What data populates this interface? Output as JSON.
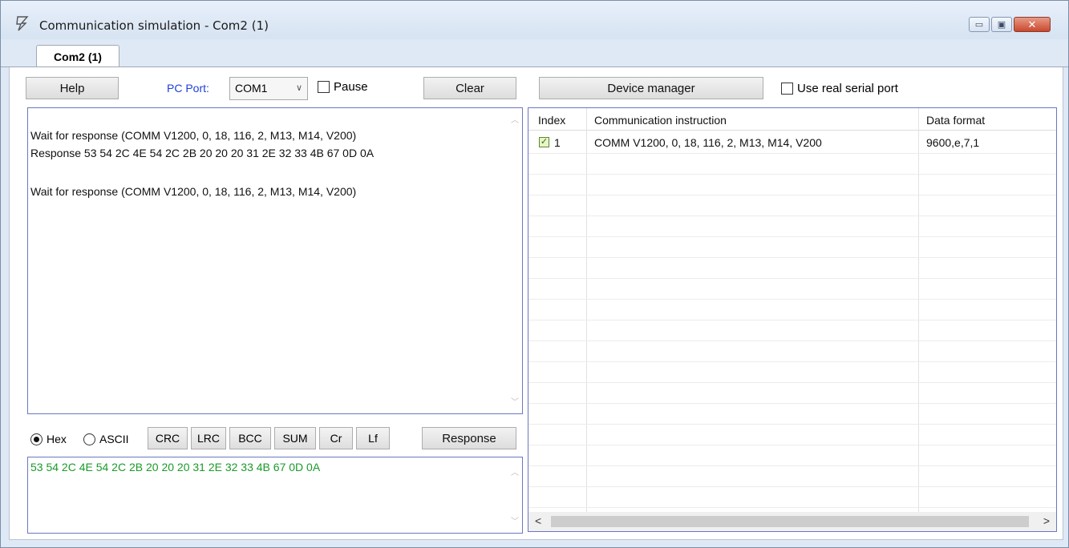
{
  "window": {
    "title": "Communication simulation - Com2 (1)",
    "minimize_glyph": "▭",
    "restore_glyph": "▣",
    "close_glyph": "✕"
  },
  "tabs": [
    {
      "label": "Com2 (1)",
      "active": true
    }
  ],
  "toolbar": {
    "help_label": "Help",
    "pc_port_label": "PC Port:",
    "pc_port_value": "COM1",
    "pause_label": "Pause",
    "pause_checked": false,
    "clear_label": "Clear",
    "device_manager_label": "Device manager",
    "use_real_serial_label": "Use real serial port",
    "use_real_serial_checked": false
  },
  "log": {
    "lines": [
      "Wait for response (COMM  V1200, 0, 18, 116, 2, M13, M14, V200)",
      "Response 53 54 2C 4E 54 2C 2B 20 20 20 31 2E 32 33 4B 67 0D 0A",
      "",
      "Wait for response (COMM  V1200, 0, 18, 116, 2, M13, M14, V200)"
    ]
  },
  "format": {
    "hex_label": "Hex",
    "ascii_label": "ASCII",
    "selected": "Hex",
    "buttons": [
      "CRC",
      "LRC",
      "BCC",
      "SUM",
      "Cr",
      "Lf"
    ],
    "response_label": "Response"
  },
  "response_text": "53 54 2C 4E 54 2C 2B 20 20 20 31 2E 32 33 4B 67 0D 0A",
  "grid": {
    "columns": [
      "Index",
      "Communication instruction",
      "Data format"
    ],
    "rows": [
      {
        "checked": true,
        "index": "1",
        "instruction": "COMM  V1200, 0, 18, 116, 2, M13, M14, V200",
        "data_format": "9600,e,7,1"
      }
    ],
    "check_glyph": "✓"
  },
  "icons": {
    "up_arrow": "︿",
    "down_arrow": "﹀",
    "left_arrow": "<",
    "right_arrow": ">",
    "combo_arrow": "∨"
  },
  "colors": {
    "accent_label": "#1e3fd8",
    "response_text": "#1a9a2a",
    "panel_border": "#6a78c2"
  }
}
